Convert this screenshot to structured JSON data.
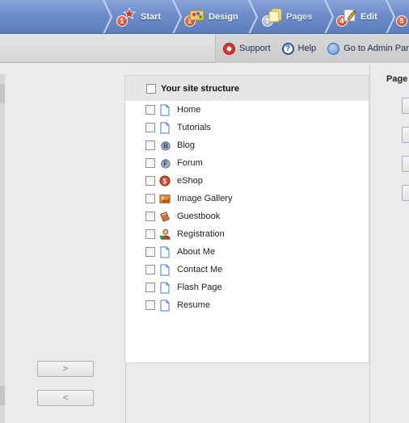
{
  "nav": {
    "steps": [
      {
        "num": "1",
        "label": "Start",
        "icon": "star-icon"
      },
      {
        "num": "2",
        "label": "Design",
        "icon": "palette-icon"
      },
      {
        "num": "3",
        "label": "Pages",
        "icon": "pages-icon"
      },
      {
        "num": "4",
        "label": "Edit",
        "icon": "edit-icon"
      },
      {
        "num": "5",
        "label": "",
        "icon": "publish-icon"
      }
    ]
  },
  "toolbar": {
    "support": "Support",
    "help": "Help",
    "admin": "Go to Admin Panel"
  },
  "structure": {
    "header": "Your site structure",
    "items": [
      {
        "label": "Home",
        "icon": "page-icon"
      },
      {
        "label": "Tutorials",
        "icon": "page-icon"
      },
      {
        "label": "Blog",
        "icon": "blog-icon"
      },
      {
        "label": "Forum",
        "icon": "forum-icon"
      },
      {
        "label": "eShop",
        "icon": "eshop-icon"
      },
      {
        "label": "Image Gallery",
        "icon": "gallery-icon"
      },
      {
        "label": "Guestbook",
        "icon": "guestbook-icon"
      },
      {
        "label": "Registration",
        "icon": "registration-icon"
      },
      {
        "label": "About Me",
        "icon": "page-icon"
      },
      {
        "label": "Contact Me",
        "icon": "page-icon"
      },
      {
        "label": "Flash Page",
        "icon": "page-icon"
      },
      {
        "label": "Resume",
        "icon": "page-icon"
      }
    ]
  },
  "buttons": {
    "add": ">",
    "remove": "<"
  },
  "right": {
    "title": "Page"
  }
}
